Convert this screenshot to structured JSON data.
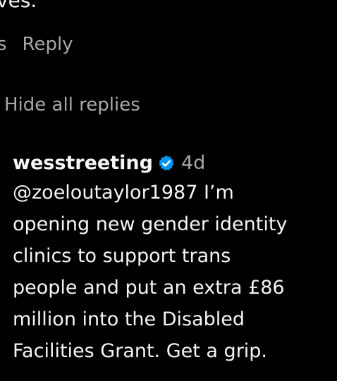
{
  "previous_comment": {
    "tail_text": "ves.",
    "likes_label": "es",
    "reply_label": "Reply"
  },
  "thread": {
    "hide_replies_label": "Hide all replies"
  },
  "reply": {
    "username": "wesstreeting",
    "verified_icon": "verified-badge-icon",
    "verified_color": "#0095f6",
    "timestamp": "4d",
    "mention": "@zoeloutaylor1987",
    "lines": [
      " I’m",
      "opening new gender identity",
      "clinics to support trans",
      "people and put an extra £86",
      "million into the Disabled",
      "Facilities Grant. Get a grip."
    ]
  },
  "colors": {
    "background": "#000000",
    "primary_text": "#f5f5f5",
    "secondary_text": "#a8a8a8"
  }
}
